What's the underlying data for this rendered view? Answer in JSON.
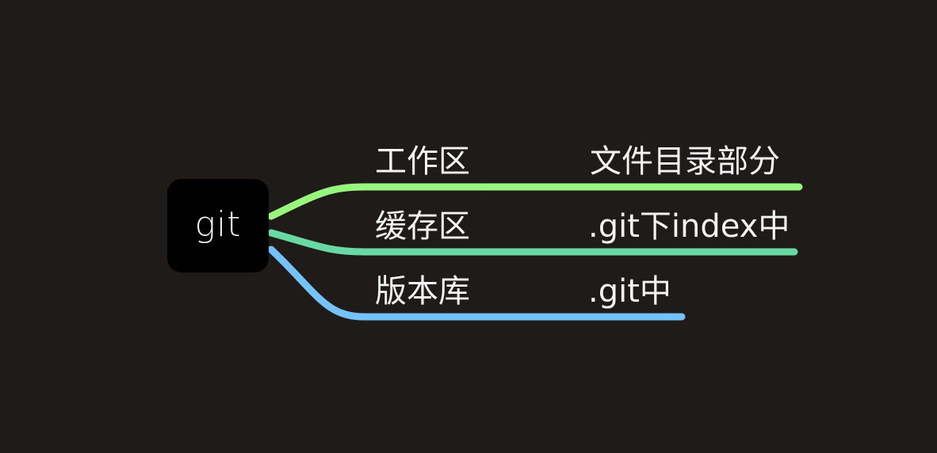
{
  "root": {
    "label": "git"
  },
  "branches": [
    {
      "label": "工作区",
      "detail": "文件目录部分",
      "color": "#98f57d"
    },
    {
      "label": "缓存区",
      "detail": ".git下index中",
      "color": "#69d9a3"
    },
    {
      "label": "版本库",
      "detail": ".git中",
      "color": "#74c3f8"
    }
  ],
  "colors": {
    "background": "#1e1b19",
    "node": "#000000",
    "text": "#f4f4f4"
  }
}
